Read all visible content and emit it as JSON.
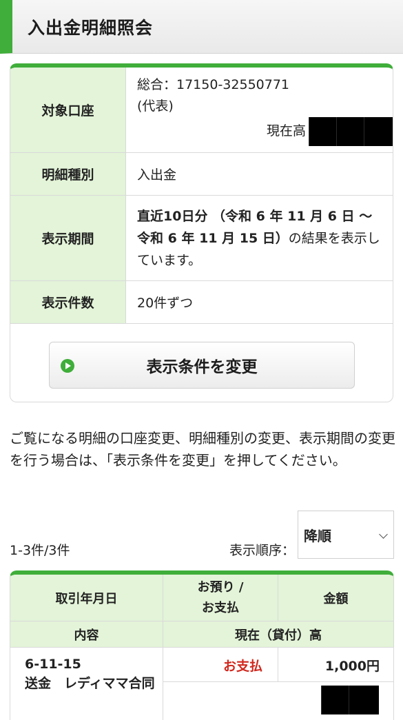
{
  "header": {
    "title": "入出金明細照会"
  },
  "account_info": {
    "account_label": "対象口座",
    "account_number": "総合：17150-32550771",
    "account_note": "(代表)",
    "balance_label": "現在高",
    "type_label": "明細種別",
    "type_value": "入出金",
    "period_label": "表示期間",
    "period_bold": "直近10日分 （令和 6 年 11 月 6 日 ～ 令和 6 年 11 月 15 日）",
    "period_suffix": "の結果を表示しています。",
    "count_label": "表示件数",
    "count_value": "20件ずつ"
  },
  "change_button": {
    "label": "表示条件を変更",
    "icon": "play-circle-icon"
  },
  "notice": "ご覧になる明細の口座変更、明細種別の変更、表示期間の変更を行う場合は、「表示条件を変更」を押してください。",
  "list_meta": {
    "result_count": "1-3件/3件",
    "order_label": "表示順序：",
    "order_value": "降順",
    "order_icon": "chevron-down-icon"
  },
  "table": {
    "headers": {
      "date": "取引年月日",
      "in_out": "お預り /\nお支払",
      "amount": "金額",
      "description": "内容",
      "balance": "現在（貸付）高"
    },
    "rows": [
      {
        "date": "6-11-15",
        "description": "送金　レディママ合同",
        "type": "お支払",
        "amount": "1,000円"
      }
    ]
  },
  "colors": {
    "accent": "#3fae3a",
    "label_bg": "#e3f4d8",
    "payment_red": "#d0281e"
  }
}
